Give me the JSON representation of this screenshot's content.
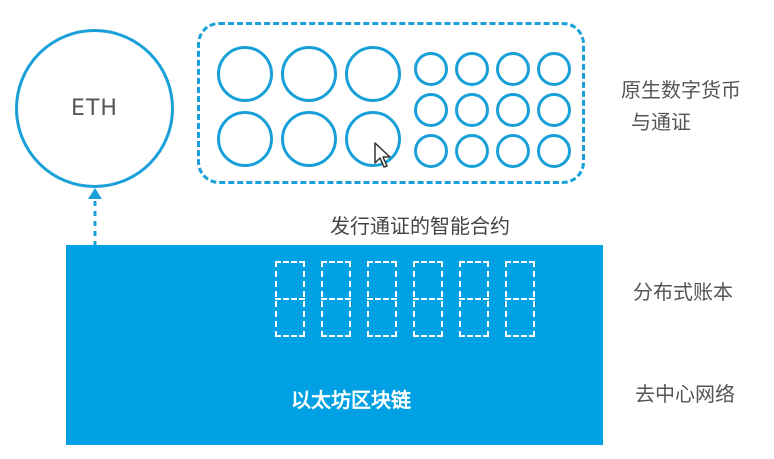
{
  "diagram": {
    "eth_label": "ETH",
    "tokens_label_line1": "原生数字货币",
    "tokens_label_line2": "与通证",
    "smart_contract_label": "发行通证的智能合约",
    "ledger_label": "分布式账本",
    "network_label": "去中心网络",
    "platform_label": "以太坊区块链"
  },
  "colors": {
    "accent": "#1aa0d8",
    "block_fill": "#00a0e4",
    "text": "#555555"
  },
  "icons": [
    "arrow-up-icon",
    "cursor-icon"
  ]
}
